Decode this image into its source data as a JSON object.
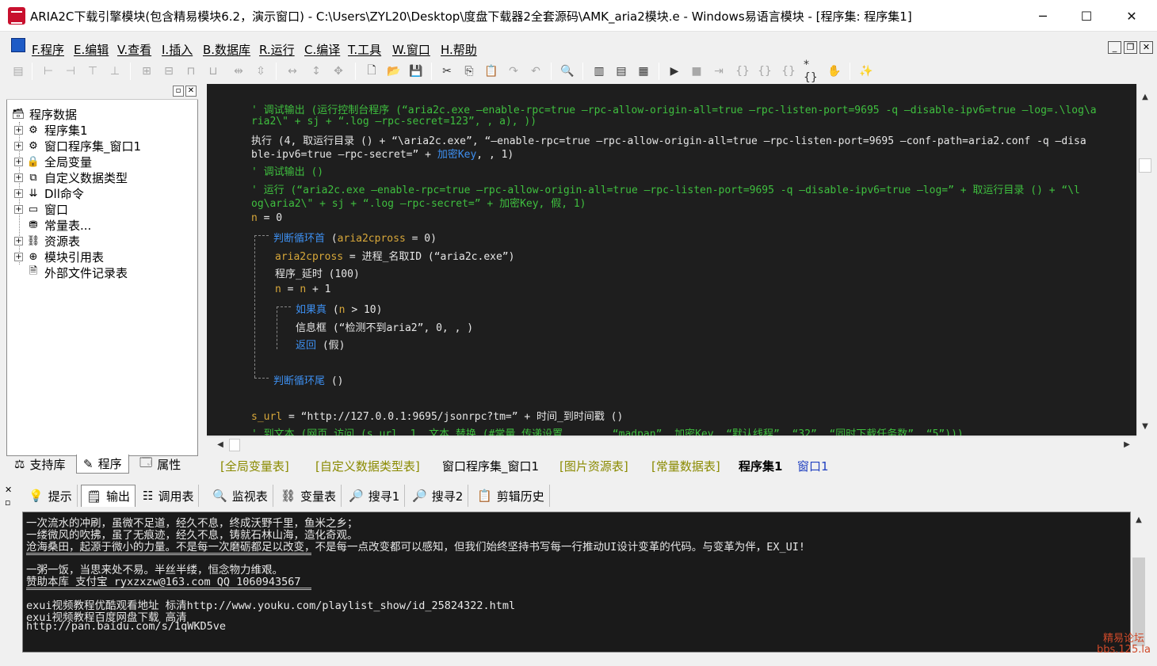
{
  "window": {
    "title": "ARIA2C下载引擎模块(包含精易模块6.2，演示窗口) - C:\\Users\\ZYL20\\Desktop\\度盘下载器2全套源码\\AMK_aria2模块.e - Windows易语言模块 - [程序集: 程序集1]",
    "minimize": "─",
    "maximize": "☐",
    "close": "✕"
  },
  "menu": {
    "items": [
      "F.程序",
      "E.编辑",
      "V.查看",
      "I.插入",
      "B.数据库",
      "R.运行",
      "C.编译",
      "T.工具",
      "W.窗口",
      "H.帮助"
    ],
    "mdi_min": "_",
    "mdi_restore": "❐",
    "mdi_close": "✕"
  },
  "tree": {
    "root": "程序数据",
    "items": [
      "程序集1",
      "窗口程序集_窗口1",
      "全局变量",
      "自定义数据类型",
      "Dll命令",
      "窗口",
      "常量表...",
      "资源表",
      "模块引用表",
      "外部文件记录表"
    ]
  },
  "left_tabs": [
    "支持库",
    "程序",
    "属性"
  ],
  "code": {
    "l1a": "' 调试输出 (运行控制台程序 (“aria2c.exe —enable-rpc=true —rpc-allow-origin-all=true —rpc-listen-port=9695 -q —disable-ipv6=true —log=.\\log\\a",
    "l1b": "ria2\\\" + sj + “.log —rpc-secret=123”, , a), ))",
    "l2a_pre": "执行 (4, 取运行目录 () + “\\aria2c.exe”, “—enable-rpc=true —rpc-allow-origin-all=true —rpc-listen-port=9695 —conf-path=aria2.conf -q —disa",
    "l2b_pre": "ble-ipv6=true —rpc-secret=” + ",
    "l2b_key": "加密Key",
    "l2b_post": ", , 1)",
    "l3": "' 调试输出 ()",
    "l4a": "' 运行 (“aria2c.exe —enable-rpc=true —rpc-allow-origin-all=true —rpc-listen-port=9695 -q —disable-ipv6=true —log=” + 取运行目录 () + “\\l",
    "l4b": "og\\aria2\\\" + sj + “.log —rpc-secret=” + 加密Key, 假, 1)",
    "l5_var": "n",
    "l5_rest": " = 0",
    "l6_key": "判断循环首",
    "l6_open": " (",
    "l6_var": "aria2cpross",
    "l6_rest": " = 0)",
    "l7_var": "aria2cpross",
    "l7_rest": " = 进程_名取ID (“aria2c.exe”)",
    "l8": "程序_延时 (100)",
    "l9_var1": "n",
    "l9_mid": " = ",
    "l9_var2": "n",
    "l9_rest": " + 1",
    "l10_key": "如果真",
    "l10_open": " (",
    "l10_var": "n",
    "l10_rest": " > 10)",
    "l11": "信息框 (“检测不到aria2”, 0, , )",
    "l12_key": "返回",
    "l12_rest": " (假)",
    "l13_key": "判断循环尾",
    "l13_rest": " ()",
    "l14_var": "s_url",
    "l14_rest": " = “http://127.0.0.1:9695/jsonrpc?tm=” + 时间_到时间戳 ()",
    "l15": "' 到文本 (网页_访问 (s_url, 1, 文本_替换 (#常量_传递设置, , , , “madpan”, 加密Key, “默认线程”, “32”, “同时下载任务数”, “5”)))"
  },
  "doc_tabs": [
    "[全局变量表]",
    "[自定义数据类型表]",
    "窗口程序集_窗口1",
    "[图片资源表]",
    "[常量数据表]",
    "程序集1",
    "窗口1"
  ],
  "output_tabs": [
    "提示",
    "输出",
    "调用表",
    "监视表",
    "变量表",
    "搜寻1",
    "搜寻2",
    "剪辑历史"
  ],
  "output_lines": [
    "一次流水的冲刷，虽微不足道，经久不息，终成沃野千里，鱼米之乡；",
    "一缕微风的吹拂，虽了无痕迹，经久不息，铸就石林山海，造化奇观。",
    "沧海桑田，起源于微小的力量。不是每一次磨砺都足以改变，不是每一点改变都可以感知，但我们始终坚持书写每一行推动UI设计变革的代码。与变革为伴，EX_UI!",
    "一粥一饭，当思来处不易。半丝半缕，恒念物力维艰。",
    "赞助本库 支付宝 ryxzxzw@163.com QQ 1060943567",
    "exui视频教程优酷观看地址 标清http://www.youku.com/playlist_show/id_25824322.html",
    "exui视频教程百度网盘下载 高清",
    "http://pan.baidu.com/s/1qWKD5ve"
  ],
  "watermark": {
    "line1": "精易论坛",
    "line2": "bbs.125.la"
  },
  "colors": {
    "comment": "#3fbf3f",
    "keyword": "#3d8ff0",
    "variable": "#d7a73a",
    "editor_bg": "#1e1e1e"
  }
}
